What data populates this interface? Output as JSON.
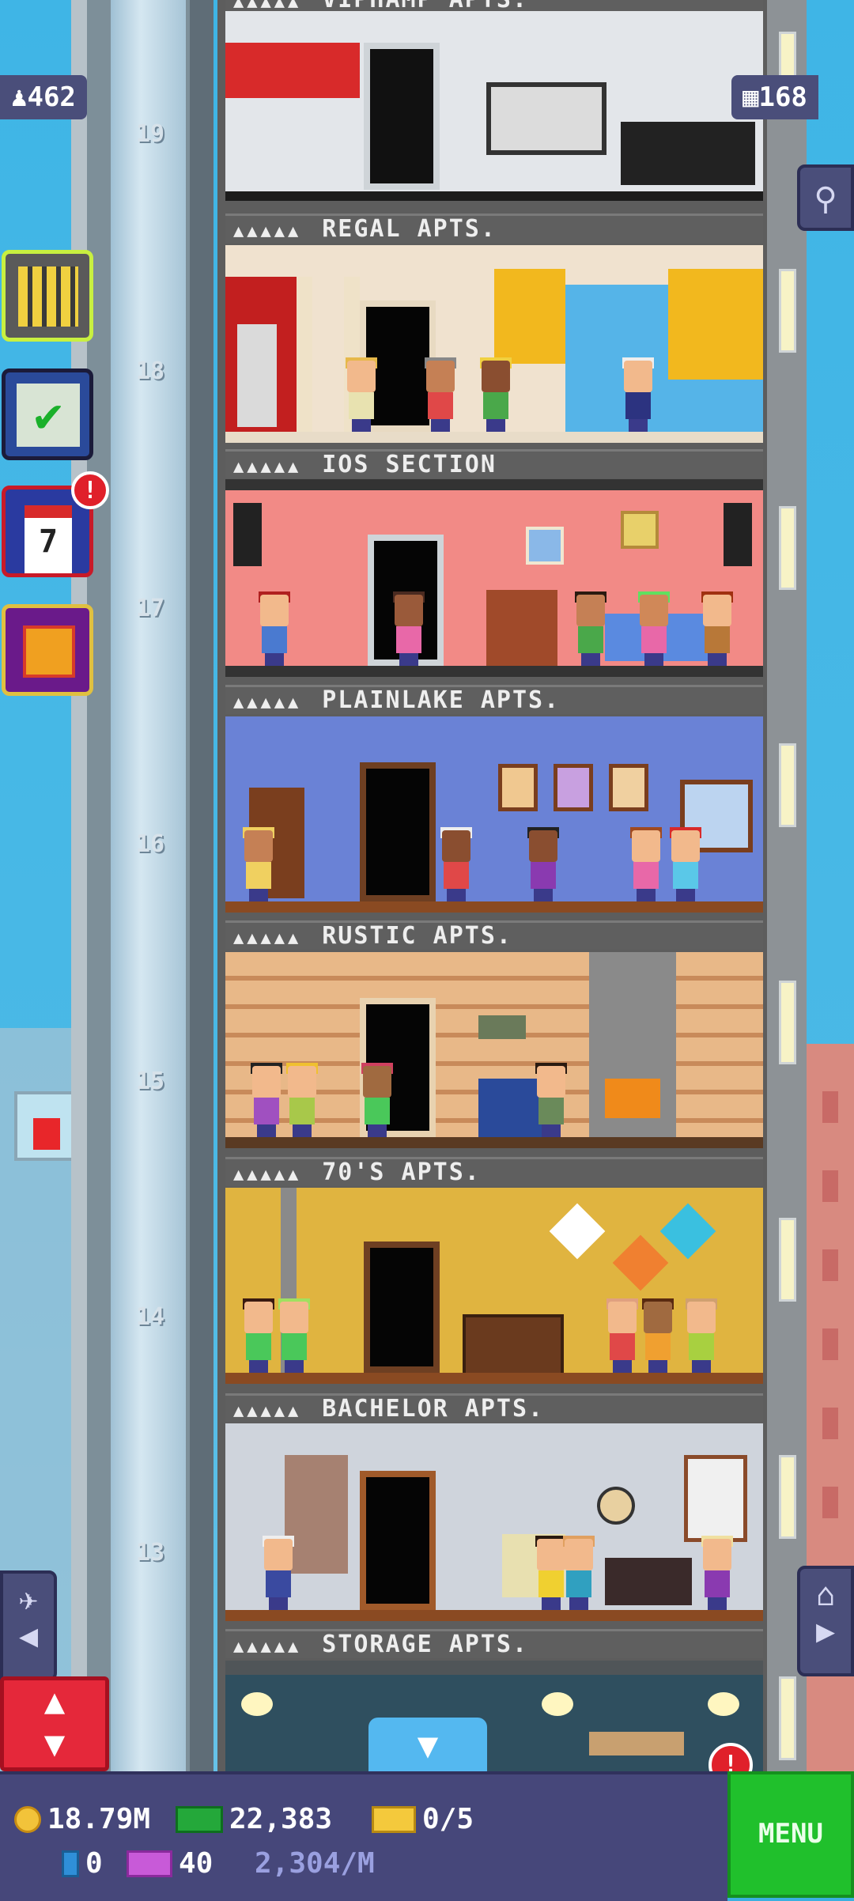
{
  "game": "Tiny Tower",
  "top_left_badge": {
    "icon": "people-icon",
    "value": "462"
  },
  "top_right_badge": {
    "icon": "floors-grid-icon",
    "value": "168"
  },
  "top_floor_label_partial": "VIPHAMP APTS.",
  "floors": [
    {
      "number": "19",
      "label": "REGAL APTS.",
      "theme": "modern"
    },
    {
      "number": "18",
      "label": "IOS SECTION",
      "theme": "regal"
    },
    {
      "number": "17",
      "label": "PLAINLAKE APTS.",
      "theme": "pink"
    },
    {
      "number": "16",
      "label": "RUSTIC APTS.",
      "theme": "blue"
    },
    {
      "number": "15",
      "label": "70'S APTS.",
      "theme": "log"
    },
    {
      "number": "14",
      "label": "BACHELOR APTS.",
      "theme": "seventies"
    },
    {
      "number": "13",
      "label": "STORAGE APTS.",
      "theme": "bachelor"
    }
  ],
  "side_buttons": [
    {
      "name": "tower-overview-button",
      "icon": "building-icon"
    },
    {
      "name": "missions-button",
      "icon": "checklist-icon"
    },
    {
      "name": "calendar-button",
      "icon": "calendar-icon",
      "calendar_day": "7",
      "alert": "!"
    },
    {
      "name": "gift-button",
      "icon": "gift-icon"
    }
  ],
  "alerts": {
    "calendar": "!",
    "bottom": "!"
  },
  "hud": {
    "coins": "18.79M",
    "tower_bux": "22,383",
    "tickets": "0/5",
    "bitizen_bux": "0",
    "vip": "40",
    "income_rate": "2,304/M",
    "menu_label": "MENU"
  },
  "colors": {
    "sky": "#3fb5e6",
    "hud_bg": "#46477a",
    "menu_green": "#20c02c",
    "elevator_red": "#e5283a",
    "down_arrow_blue": "#54b8f0"
  }
}
